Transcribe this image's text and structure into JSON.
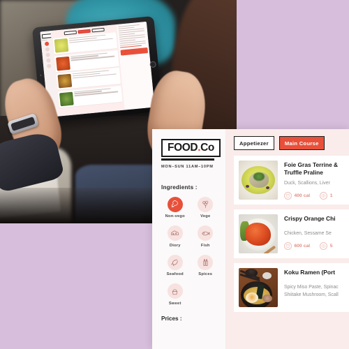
{
  "brand": {
    "name_main": "FOOD",
    "name_dot": ".",
    "name_suffix": "Co",
    "hours": "MON–SUN   11AM–10PM"
  },
  "sidebar": {
    "ingredients_title": "Ingredients :",
    "prices_title": "Prices :",
    "ingredients": [
      {
        "label": "Non-vego",
        "icon": "drumstick-icon",
        "selected": true
      },
      {
        "label": "Vege",
        "icon": "broccoli-icon",
        "selected": false
      },
      {
        "label": "Diory",
        "icon": "cheese-icon",
        "selected": false
      },
      {
        "label": "Fish",
        "icon": "fish-icon",
        "selected": false
      },
      {
        "label": "Seafood",
        "icon": "shrimp-icon",
        "selected": false
      },
      {
        "label": "Spices",
        "icon": "spices-icon",
        "selected": false
      },
      {
        "label": "Sweet",
        "icon": "cupcake-icon",
        "selected": false
      }
    ]
  },
  "tabs": [
    {
      "label": "Appetiezer",
      "active": false
    },
    {
      "label": "Main Course",
      "active": true
    }
  ],
  "menu_items": [
    {
      "name": "Foie Gras Terrine &",
      "name_line2": "Truffle Praline",
      "description": "Duck, Scallions, Liver",
      "calories": "400 cal",
      "views": "1",
      "image": "foie-gras-photo"
    },
    {
      "name": "Crispy Orange Chi",
      "name_line2": "",
      "description": "Chicken, Sessame Se",
      "calories": "600 cal",
      "views": "5",
      "image": "orange-chicken-photo"
    },
    {
      "name": "Koku Ramen (Port",
      "name_line2": "",
      "description": "Spicy Miso Paste, Spinac",
      "description2": "Shiitake Mushroom, Scall",
      "calories": "",
      "views": "",
      "image": "ramen-photo"
    }
  ],
  "colors": {
    "accent": "#e8503a",
    "background_lavender": "#d6bedc",
    "content_pink": "#f9ecea",
    "panel_white": "#fbf9f9",
    "meta_text": "#e09086"
  }
}
